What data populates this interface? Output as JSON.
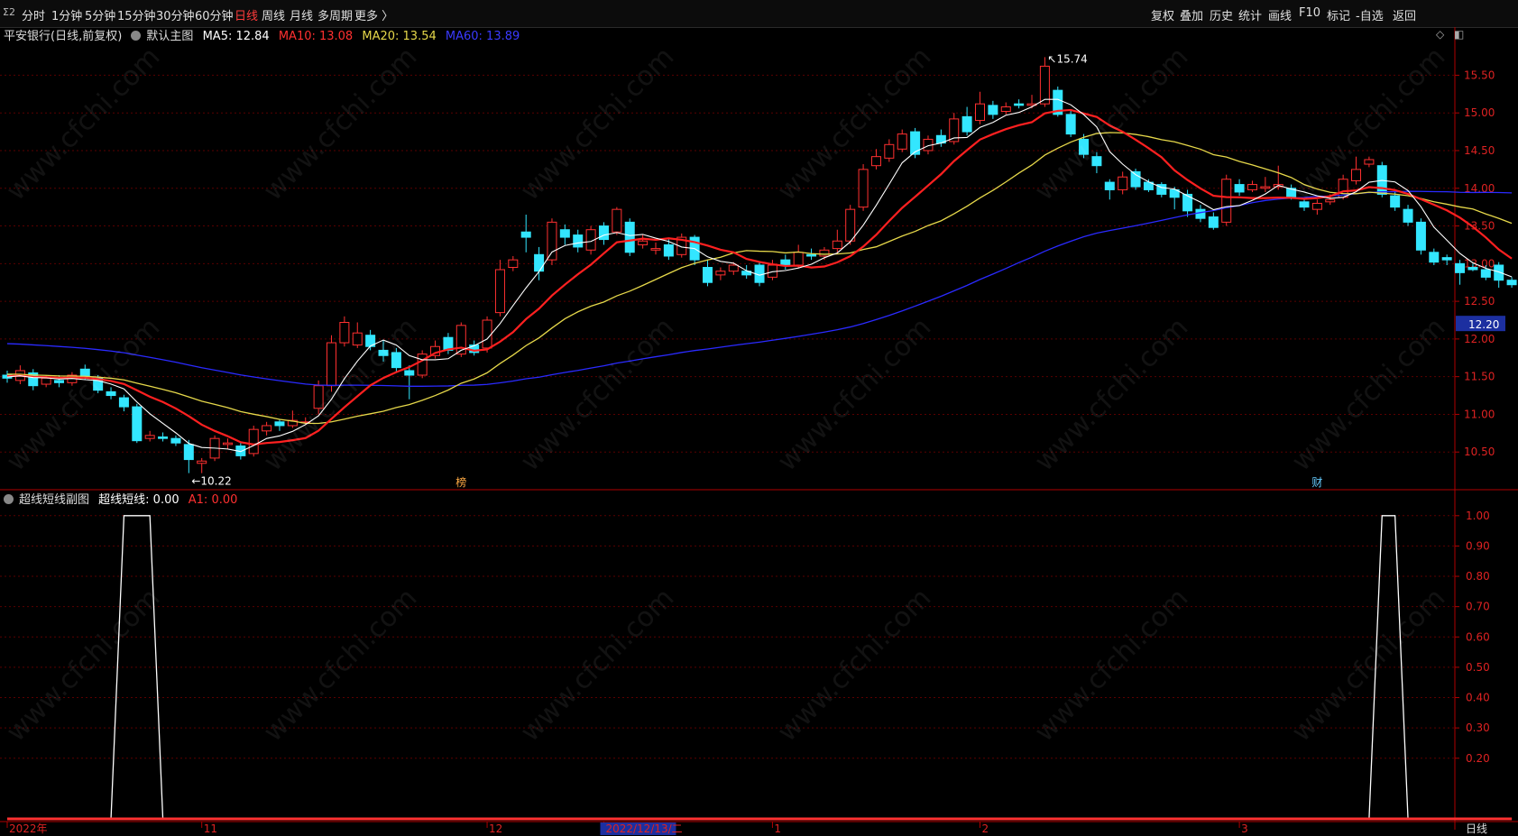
{
  "toolbar": {
    "logo": "Σ2",
    "periods": [
      "分时",
      "1分钟",
      "5分钟",
      "15分钟",
      "30分钟",
      "60分钟",
      "日线",
      "周线",
      "月线",
      "多周期",
      "更多 〉"
    ],
    "active_period": "日线",
    "right_buttons": [
      "复权",
      "叠加",
      "历史",
      "统计",
      "画线",
      "F10",
      "标记",
      "-自选",
      "返回"
    ]
  },
  "main_info": {
    "stock": "平安银行(日线,前复权)",
    "chart_name": "默认主图",
    "ma5": "MA5: 12.84",
    "ma10": "MA10: 13.08",
    "ma20": "MA20: 13.54",
    "ma60": "MA60: 13.89"
  },
  "sub_info": {
    "name": "超线短线副图",
    "v1": "超线短线: 0.00",
    "v2": "A1: 0.00"
  },
  "colors": {
    "up": "#ff3030",
    "down": "#33e6ff",
    "ma5": "#ffffff",
    "ma10": "#ff2020",
    "ma20": "#e6d84a",
    "ma60": "#2a2aff",
    "grid": "#5a0000",
    "axis": "#b00000"
  },
  "watermark": "www.cfchi.com",
  "chart_data": [
    {
      "type": "candlestick",
      "title": "平安银行(日线,前复权)",
      "ylim": [
        10.0,
        15.9
      ],
      "y_ticks": [
        "15.50",
        "15.00",
        "14.50",
        "14.00",
        "13.50",
        "13.00",
        "12.50",
        "12.00",
        "11.50",
        "11.00",
        "10.50"
      ],
      "current_price": "12.20",
      "high_label": "15.74",
      "low_label": "10.22",
      "x_labels": [
        "2022年",
        "11",
        "12",
        "2022/12/13/二",
        "1",
        "2",
        "3"
      ],
      "x_label_index": [
        0,
        15,
        37,
        46,
        59,
        75,
        95
      ],
      "event_marks": [
        {
          "index": 35,
          "text": "榜"
        },
        {
          "index": 101,
          "text": "财"
        }
      ],
      "candles": [
        [
          11.52,
          11.48,
          11.58,
          11.42
        ],
        [
          11.45,
          11.58,
          11.65,
          11.4
        ],
        [
          11.55,
          11.38,
          11.6,
          11.32
        ],
        [
          11.4,
          11.48,
          11.52,
          11.36
        ],
        [
          11.45,
          11.42,
          11.52,
          11.36
        ],
        [
          11.42,
          11.52,
          11.56,
          11.38
        ],
        [
          11.6,
          11.5,
          11.66,
          11.46
        ],
        [
          11.48,
          11.32,
          11.52,
          11.28
        ],
        [
          11.3,
          11.25,
          11.36,
          11.2
        ],
        [
          11.22,
          11.1,
          11.26,
          11.04
        ],
        [
          11.1,
          10.65,
          11.14,
          10.62
        ],
        [
          10.68,
          10.72,
          10.78,
          10.64
        ],
        [
          10.7,
          10.68,
          10.76,
          10.64
        ],
        [
          10.68,
          10.62,
          10.72,
          10.58
        ],
        [
          10.6,
          10.4,
          10.66,
          10.22
        ],
        [
          10.35,
          10.38,
          10.42,
          10.22
        ],
        [
          10.42,
          10.68,
          10.72,
          10.38
        ],
        [
          10.6,
          10.62,
          10.68,
          10.54
        ],
        [
          10.58,
          10.45,
          10.62,
          10.4
        ],
        [
          10.48,
          10.8,
          10.85,
          10.44
        ],
        [
          10.78,
          10.85,
          10.9,
          10.72
        ],
        [
          10.9,
          10.85,
          10.94,
          10.78
        ],
        [
          10.85,
          10.92,
          11.05,
          10.82
        ],
        [
          10.9,
          10.9,
          10.96,
          10.86
        ],
        [
          11.08,
          11.38,
          11.45,
          11.0
        ],
        [
          11.38,
          11.95,
          12.05,
          11.3
        ],
        [
          11.95,
          12.22,
          12.3,
          11.9
        ],
        [
          11.92,
          12.08,
          12.22,
          11.88
        ],
        [
          12.05,
          11.9,
          12.12,
          11.85
        ],
        [
          11.85,
          11.78,
          11.98,
          11.7
        ],
        [
          11.82,
          11.62,
          11.88,
          11.56
        ],
        [
          11.58,
          11.52,
          11.65,
          11.2
        ],
        [
          11.52,
          11.8,
          11.85,
          11.48
        ],
        [
          11.78,
          11.9,
          11.98,
          11.74
        ],
        [
          12.02,
          11.85,
          12.08,
          11.8
        ],
        [
          11.8,
          12.18,
          12.22,
          11.76
        ],
        [
          11.92,
          11.82,
          11.98,
          11.78
        ],
        [
          11.88,
          12.25,
          12.3,
          11.82
        ],
        [
          12.35,
          12.92,
          13.05,
          12.3
        ],
        [
          12.95,
          13.05,
          13.1,
          12.9
        ],
        [
          13.42,
          13.35,
          13.65,
          13.15
        ],
        [
          13.12,
          12.9,
          13.22,
          12.78
        ],
        [
          13.05,
          13.55,
          13.6,
          12.98
        ],
        [
          13.45,
          13.35,
          13.52,
          13.25
        ],
        [
          13.38,
          13.22,
          13.45,
          13.15
        ],
        [
          13.18,
          13.45,
          13.5,
          13.12
        ],
        [
          13.5,
          13.32,
          13.55,
          13.25
        ],
        [
          13.42,
          13.72,
          13.75,
          13.38
        ],
        [
          13.55,
          13.15,
          13.6,
          13.1
        ],
        [
          13.25,
          13.3,
          13.38,
          13.2
        ],
        [
          13.18,
          13.2,
          13.28,
          13.12
        ],
        [
          13.25,
          13.1,
          13.32,
          13.05
        ],
        [
          13.12,
          13.35,
          13.4,
          13.08
        ],
        [
          13.35,
          13.05,
          13.38,
          12.98
        ],
        [
          12.95,
          12.75,
          13.05,
          12.7
        ],
        [
          12.85,
          12.9,
          12.95,
          12.78
        ],
        [
          12.9,
          12.98,
          13.02,
          12.85
        ],
        [
          12.9,
          12.85,
          12.98,
          12.8
        ],
        [
          12.98,
          12.75,
          13.02,
          12.7
        ],
        [
          12.82,
          12.98,
          13.05,
          12.78
        ],
        [
          13.05,
          12.98,
          13.12,
          12.92
        ],
        [
          12.98,
          13.15,
          13.25,
          12.94
        ],
        [
          13.12,
          13.1,
          13.2,
          13.05
        ],
        [
          13.1,
          13.18,
          13.22,
          13.05
        ],
        [
          13.2,
          13.3,
          13.45,
          13.15
        ],
        [
          13.3,
          13.72,
          13.78,
          13.25
        ],
        [
          13.75,
          14.25,
          14.32,
          13.7
        ],
        [
          14.3,
          14.42,
          14.52,
          14.25
        ],
        [
          14.4,
          14.58,
          14.65,
          14.35
        ],
        [
          14.52,
          14.72,
          14.78,
          14.48
        ],
        [
          14.75,
          14.45,
          14.8,
          14.4
        ],
        [
          14.5,
          14.65,
          14.7,
          14.45
        ],
        [
          14.7,
          14.6,
          14.78,
          14.55
        ],
        [
          14.62,
          14.92,
          15.0,
          14.58
        ],
        [
          14.95,
          14.75,
          15.08,
          14.7
        ],
        [
          14.9,
          15.12,
          15.28,
          14.85
        ],
        [
          15.1,
          14.98,
          15.16,
          14.92
        ],
        [
          15.02,
          15.08,
          15.14,
          14.98
        ],
        [
          15.12,
          15.1,
          15.18,
          15.06
        ],
        [
          15.1,
          15.12,
          15.24,
          15.06
        ],
        [
          15.12,
          15.62,
          15.74,
          15.08
        ],
        [
          15.3,
          14.98,
          15.35,
          14.95
        ],
        [
          14.98,
          14.72,
          15.05,
          14.68
        ],
        [
          14.65,
          14.45,
          14.72,
          14.4
        ],
        [
          14.42,
          14.3,
          14.48,
          14.2
        ],
        [
          14.08,
          13.98,
          14.12,
          13.85
        ],
        [
          13.98,
          14.15,
          14.22,
          13.92
        ],
        [
          14.22,
          14.02,
          14.26,
          13.98
        ],
        [
          14.08,
          13.98,
          14.12,
          13.95
        ],
        [
          14.05,
          13.92,
          14.08,
          13.88
        ],
        [
          13.98,
          13.88,
          14.02,
          13.72
        ],
        [
          13.92,
          13.7,
          13.98,
          13.62
        ],
        [
          13.72,
          13.6,
          13.78,
          13.55
        ],
        [
          13.62,
          13.48,
          13.68,
          13.45
        ],
        [
          13.55,
          14.12,
          14.18,
          13.5
        ],
        [
          14.05,
          13.95,
          14.12,
          13.9
        ],
        [
          13.98,
          14.05,
          14.1,
          13.95
        ],
        [
          14.0,
          14.02,
          14.15,
          13.95
        ],
        [
          14.02,
          14.05,
          14.3,
          13.98
        ],
        [
          14.0,
          13.88,
          14.05,
          13.85
        ],
        [
          13.82,
          13.75,
          13.88,
          13.7
        ],
        [
          13.72,
          13.8,
          13.85,
          13.65
        ],
        [
          13.82,
          13.85,
          13.92,
          13.78
        ],
        [
          13.88,
          14.12,
          14.18,
          13.85
        ],
        [
          14.1,
          14.25,
          14.42,
          14.05
        ],
        [
          14.32,
          14.38,
          14.42,
          14.28
        ],
        [
          14.3,
          13.92,
          14.35,
          13.88
        ],
        [
          13.9,
          13.75,
          13.95,
          13.7
        ],
        [
          13.72,
          13.55,
          13.78,
          13.5
        ],
        [
          13.55,
          13.18,
          13.6,
          13.12
        ],
        [
          13.15,
          13.02,
          13.2,
          12.98
        ],
        [
          13.08,
          13.05,
          13.12,
          12.98
        ],
        [
          13.0,
          12.88,
          13.05,
          12.72
        ],
        [
          12.95,
          12.92,
          13.0,
          12.9
        ],
        [
          12.92,
          12.82,
          12.98,
          12.78
        ],
        [
          12.98,
          12.78,
          13.02,
          12.68
        ],
        [
          12.78,
          12.72,
          12.82,
          12.68
        ]
      ]
    },
    {
      "type": "line",
      "title": "超线短线副图",
      "ylim": [
        0.0,
        1.05
      ],
      "y_ticks": [
        "1.00",
        "0.90",
        "0.80",
        "0.70",
        "0.60",
        "0.50",
        "0.40",
        "0.30",
        "0.20"
      ],
      "series": [
        {
          "name": "超线短线",
          "pulses": [
            [
              9,
              11
            ],
            [
              106,
              107
            ]
          ]
        },
        {
          "name": "A1",
          "values_constant": 0.0
        }
      ]
    }
  ]
}
